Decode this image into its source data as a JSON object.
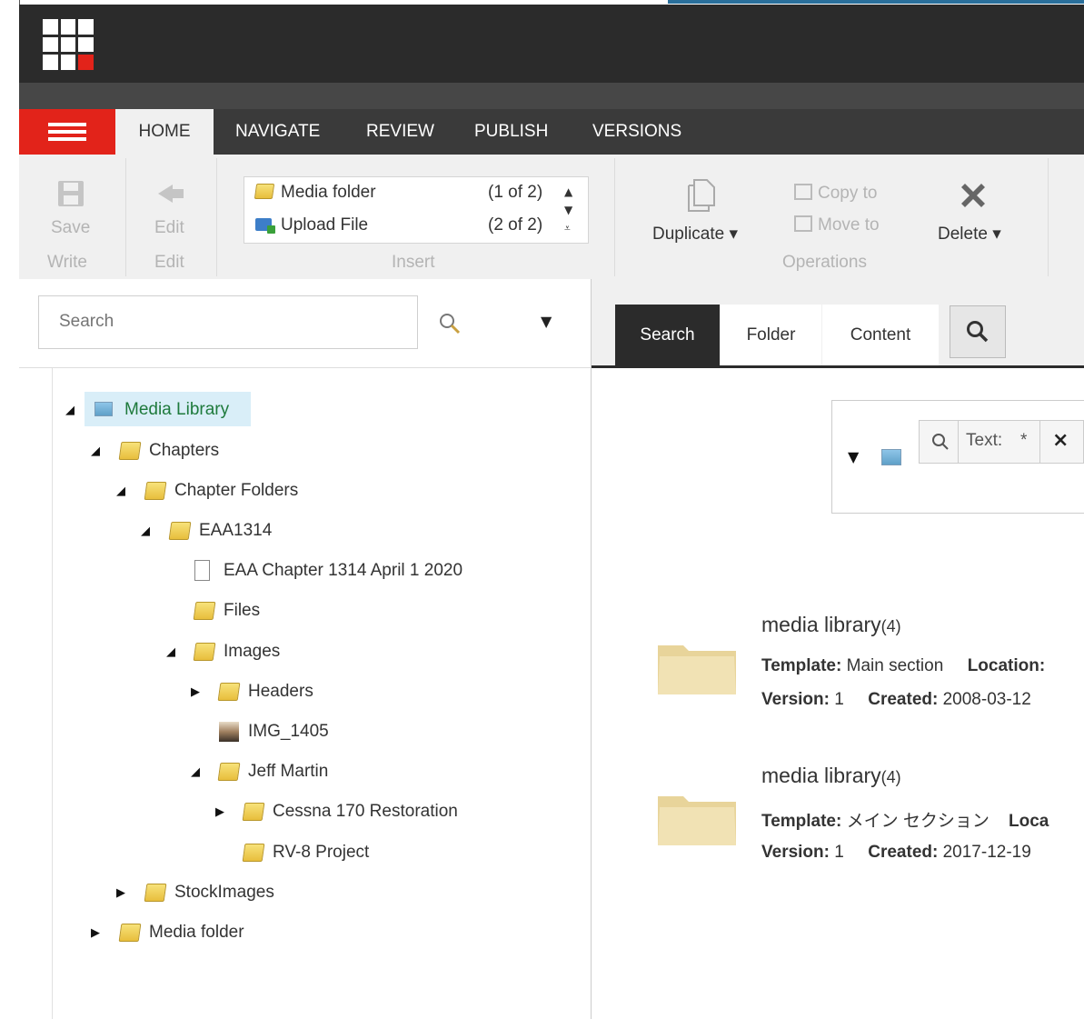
{
  "tabs": [
    {
      "label": "HOME"
    },
    {
      "label": "NAVIGATE"
    },
    {
      "label": "REVIEW"
    },
    {
      "label": "PUBLISH"
    },
    {
      "label": "VERSIONS"
    }
  ],
  "ribbon": {
    "save": "Save",
    "write": "Write",
    "edit": "Edit",
    "edit_group": "Edit",
    "insert_group": "Insert",
    "insert_items": [
      {
        "label": "Media folder",
        "count": "(1 of 2)"
      },
      {
        "label": "Upload File",
        "count": "(2 of 2)"
      }
    ],
    "duplicate": "Duplicate",
    "copy_to": "Copy to",
    "move_to": "Move to",
    "delete": "Delete",
    "operations_group": "Operations"
  },
  "search": {
    "placeholder": "Search"
  },
  "tree": {
    "media_library": "Media Library",
    "chapters": "Chapters",
    "chapter_folders": "Chapter Folders",
    "eaa1314": "EAA1314",
    "eaa_chapter": "EAA Chapter 1314 April 1 2020",
    "files": "Files",
    "images": "Images",
    "headers": "Headers",
    "img_1405": "IMG_1405",
    "jeff_martin": "Jeff Martin",
    "cessna": "Cessna 170 Restoration",
    "rv8": "RV-8 Project",
    "stockimages": "StockImages",
    "media_folder": "Media folder"
  },
  "right_tabs": [
    {
      "label": "Search"
    },
    {
      "label": "Folder"
    },
    {
      "label": "Content"
    }
  ],
  "filter": {
    "chip_text": "Text:",
    "chip_value": "*",
    "chip_close": "×"
  },
  "results": [
    {
      "name": "media library",
      "count": "(4)",
      "template_label": "Template:",
      "template": "Main section",
      "location_label": "Location:",
      "version_label": "Version:",
      "version": "1",
      "created_label": "Created:",
      "created": "2008-03-12"
    },
    {
      "name": "media library",
      "count": "(4)",
      "template_label": "Template:",
      "template": "メイン セクション",
      "location_label": "Loca",
      "version_label": "Version:",
      "version": "1",
      "created_label": "Created:",
      "created": "2017-12-19"
    }
  ],
  "colors": {
    "accent_red": "#e2231a",
    "dark_bar": "#2b2b2b",
    "tree_selected": "#d9eef8",
    "link_green": "#1e7a3c"
  }
}
